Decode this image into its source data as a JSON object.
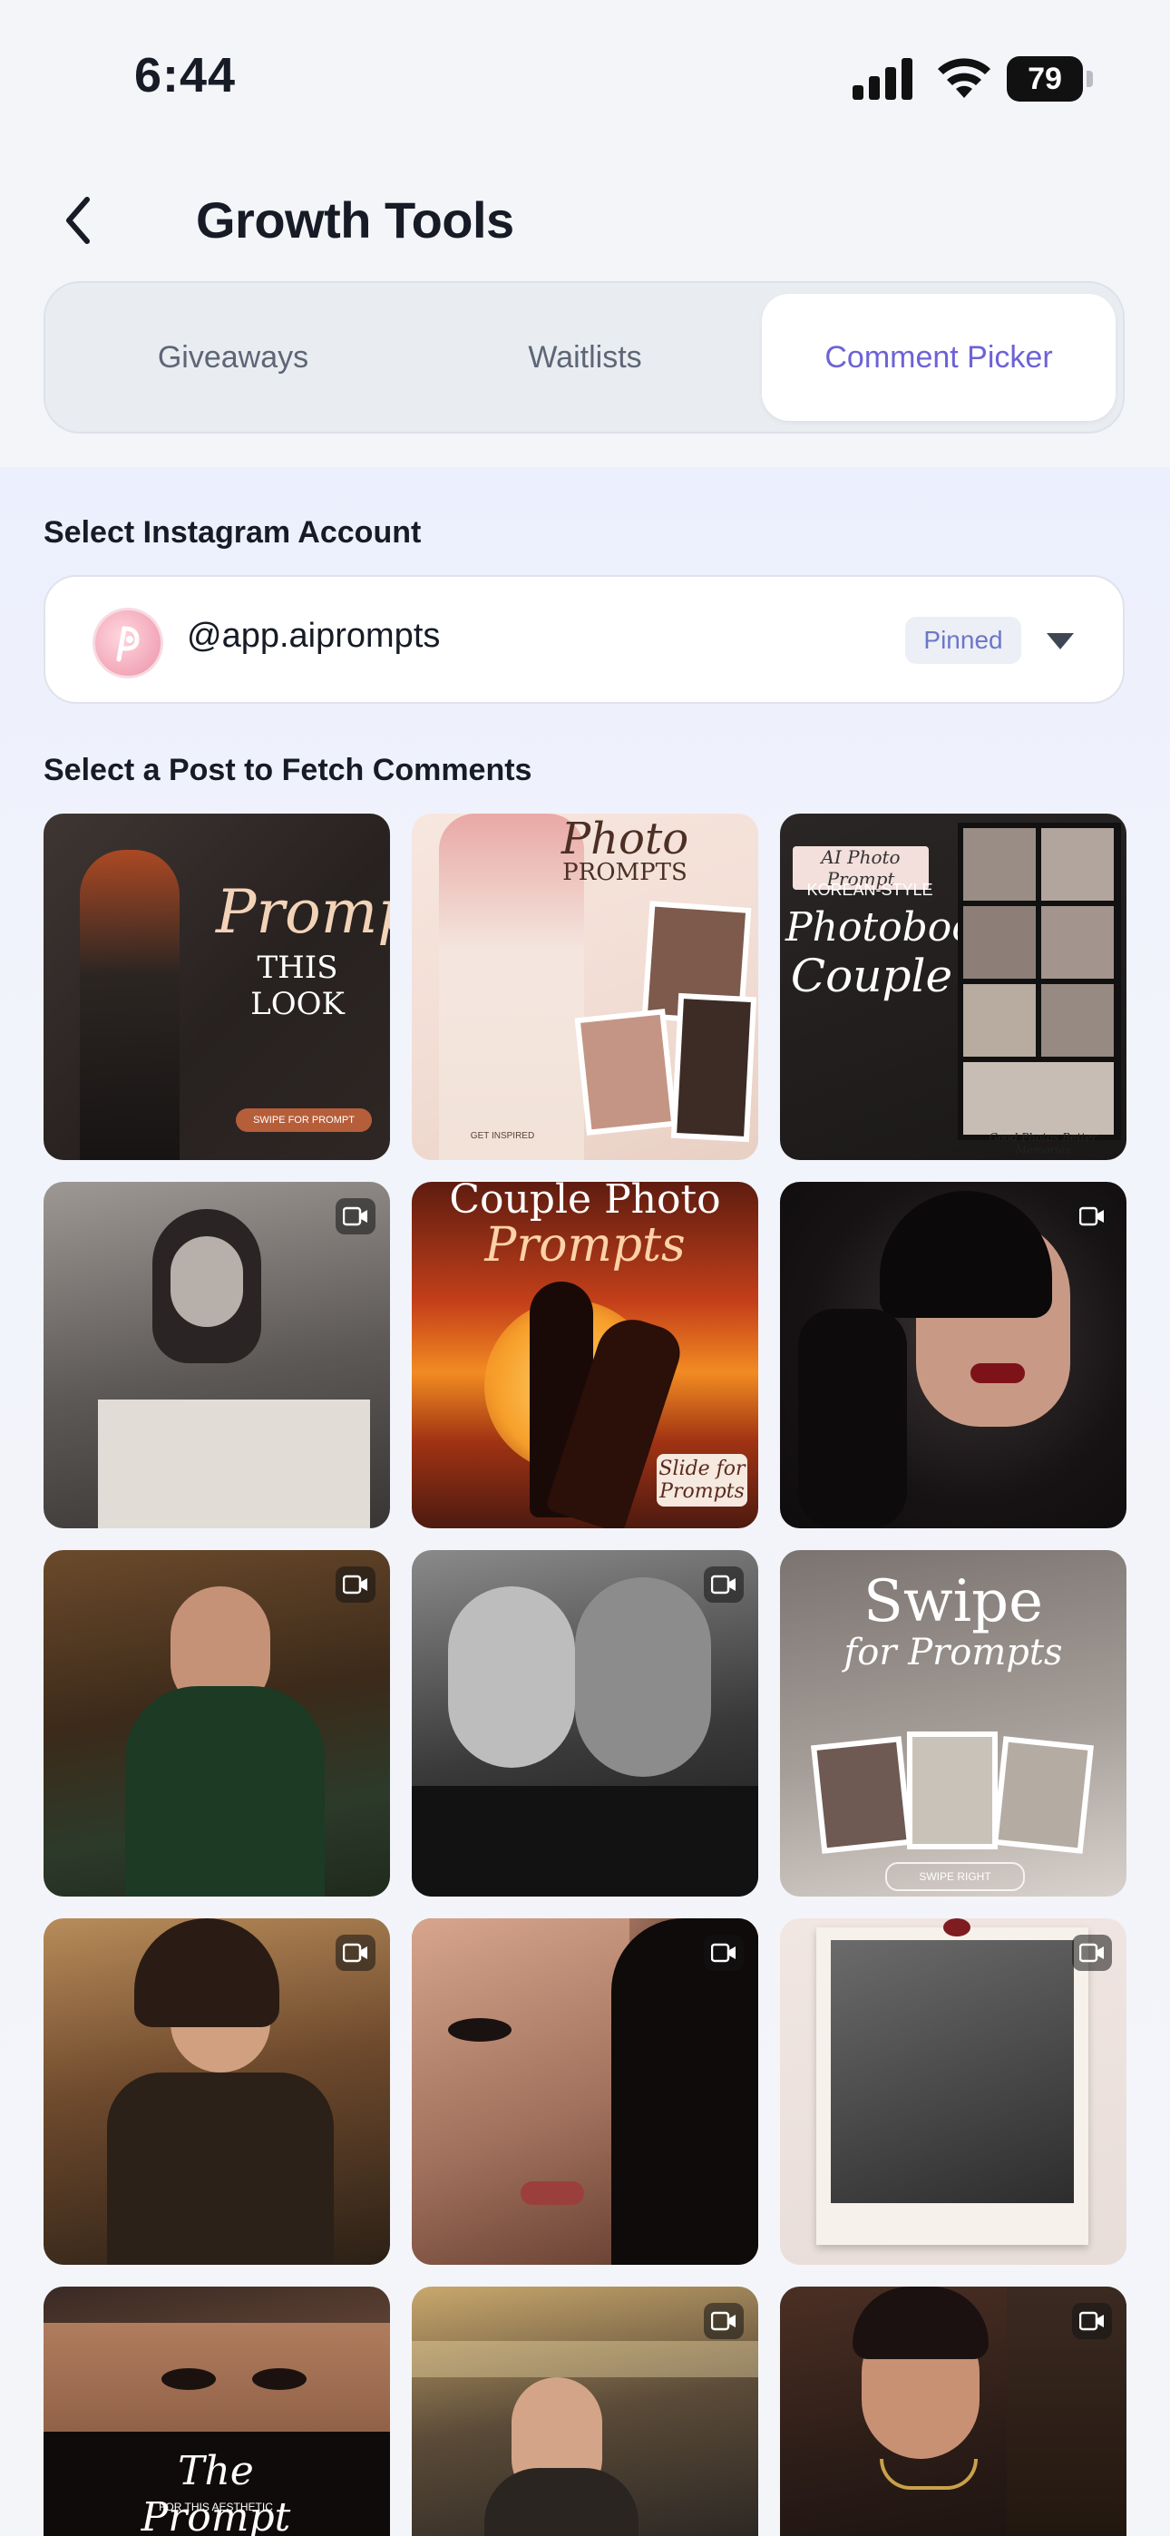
{
  "status_bar": {
    "time": "6:44",
    "battery": "79"
  },
  "header": {
    "title": "Growth Tools"
  },
  "tabs": [
    {
      "label": "Giveaways",
      "active": false
    },
    {
      "label": "Waitlists",
      "active": false
    },
    {
      "label": "Comment Picker",
      "active": true
    }
  ],
  "account_section": {
    "label": "Select Instagram Account",
    "account_name": "@app.aiprompts",
    "badge": "Pinned"
  },
  "posts_section": {
    "label": "Select a Post to Fetch Comments"
  },
  "posts": [
    {
      "lines": [
        "Prompt",
        "THIS LOOK"
      ],
      "footer": "SWIPE FOR PROMPT",
      "is_video": false
    },
    {
      "lines": [
        "Photo",
        "PROMPTS"
      ],
      "footer": "GET INSPIRED",
      "is_video": false
    },
    {
      "lines": [
        "AI Photo Prompt",
        "KOREAN-STYLE",
        "Photobooth",
        "Couple"
      ],
      "footer": "Good Photos Better Memories",
      "is_video": false
    },
    {
      "lines": [],
      "footer": "",
      "is_video": true
    },
    {
      "lines": [
        "Couple Photo",
        "Prompts"
      ],
      "footer": "Slide for Prompts",
      "is_video": false
    },
    {
      "lines": [],
      "footer": "",
      "is_video": true
    },
    {
      "lines": [],
      "footer": "",
      "is_video": true
    },
    {
      "lines": [],
      "footer": "",
      "is_video": true
    },
    {
      "lines": [
        "Swipe",
        "for Prompts"
      ],
      "footer": "SWIPE RIGHT",
      "is_video": false
    },
    {
      "lines": [],
      "footer": "",
      "is_video": true
    },
    {
      "lines": [],
      "footer": "",
      "is_video": true
    },
    {
      "lines": [],
      "footer": "",
      "is_video": true
    },
    {
      "lines": [
        "The Prompt",
        "FOR THIS AESTHETIC"
      ],
      "footer": "",
      "is_video": false
    },
    {
      "lines": [],
      "footer": "",
      "is_video": true
    },
    {
      "lines": [],
      "footer": "",
      "is_video": true
    }
  ],
  "colors": {
    "accent": "#6e62d6",
    "badge_text": "#6e76c8"
  },
  "icons": {
    "back": "chevron-left-icon",
    "dropdown": "caret-down-icon",
    "video": "video-camera-icon"
  }
}
